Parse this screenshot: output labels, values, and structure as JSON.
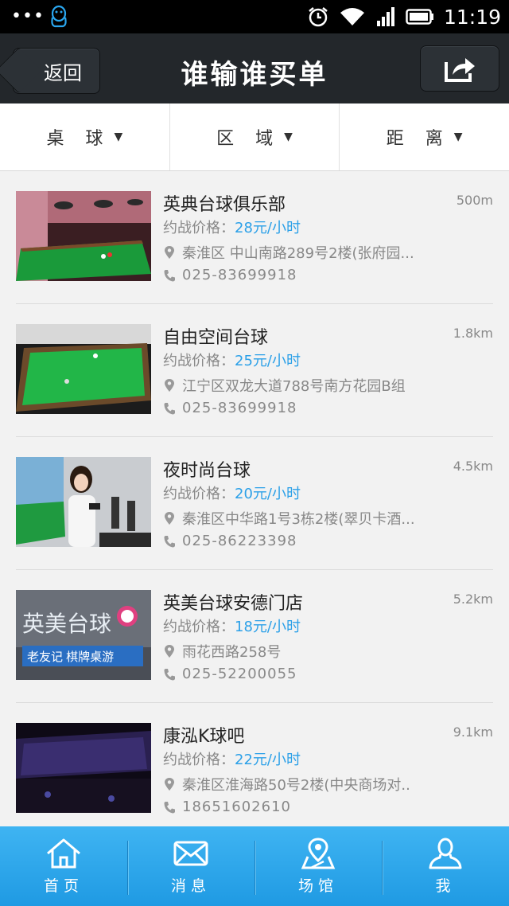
{
  "status_bar": {
    "time": "11:19",
    "dots": "•••",
    "icons": [
      "qq-penguin-icon",
      "alarm-icon",
      "wifi-icon",
      "signal-icon",
      "battery-icon"
    ]
  },
  "header": {
    "back_label": "返回",
    "title": "谁输谁买单",
    "share_icon": "share-icon"
  },
  "filters": [
    {
      "label": "桌 球"
    },
    {
      "label": "区 域"
    },
    {
      "label": "距 离"
    }
  ],
  "venues": [
    {
      "name": "英典台球俱乐部",
      "distance": "500m",
      "price_label": "约战价格：",
      "price": "28元/小时",
      "address": "秦淮区 中山南路289号2楼(张府园...",
      "phone": "025-83699918"
    },
    {
      "name": "自由空间台球",
      "distance": "1.8km",
      "price_label": "约战价格：",
      "price": "25元/小时",
      "address": "江宁区双龙大道788号南方花园B组",
      "phone": "025-83699918"
    },
    {
      "name": "夜时尚台球",
      "distance": "4.5km",
      "price_label": "约战价格：",
      "price": "20元/小时",
      "address": "秦淮区中华路1号3栋2楼(翠贝卡酒...",
      "phone": "025-86223398"
    },
    {
      "name": "英美台球安德门店",
      "distance": "5.2km",
      "price_label": "约战价格：",
      "price": "18元/小时",
      "address": "雨花西路258号",
      "phone": "025-52200055",
      "sign_text": "英美台球",
      "sign_sub": "老友记 棋牌桌游"
    },
    {
      "name": "康泓K球吧",
      "distance": "9.1km",
      "price_label": "约战价格：",
      "price": "22元/小时",
      "address": "秦淮区淮海路50号2楼(中央商场对..",
      "phone": "18651602610"
    }
  ],
  "tabs": [
    {
      "label": "首页",
      "icon": "home-icon"
    },
    {
      "label": "消息",
      "icon": "mail-icon"
    },
    {
      "label": "场馆",
      "icon": "map-pin-icon"
    },
    {
      "label": "我",
      "icon": "user-icon"
    }
  ],
  "colors": {
    "accent": "#2ba0e8",
    "nav_bg": "#23272b",
    "tab_bg": "#29a6ec"
  }
}
